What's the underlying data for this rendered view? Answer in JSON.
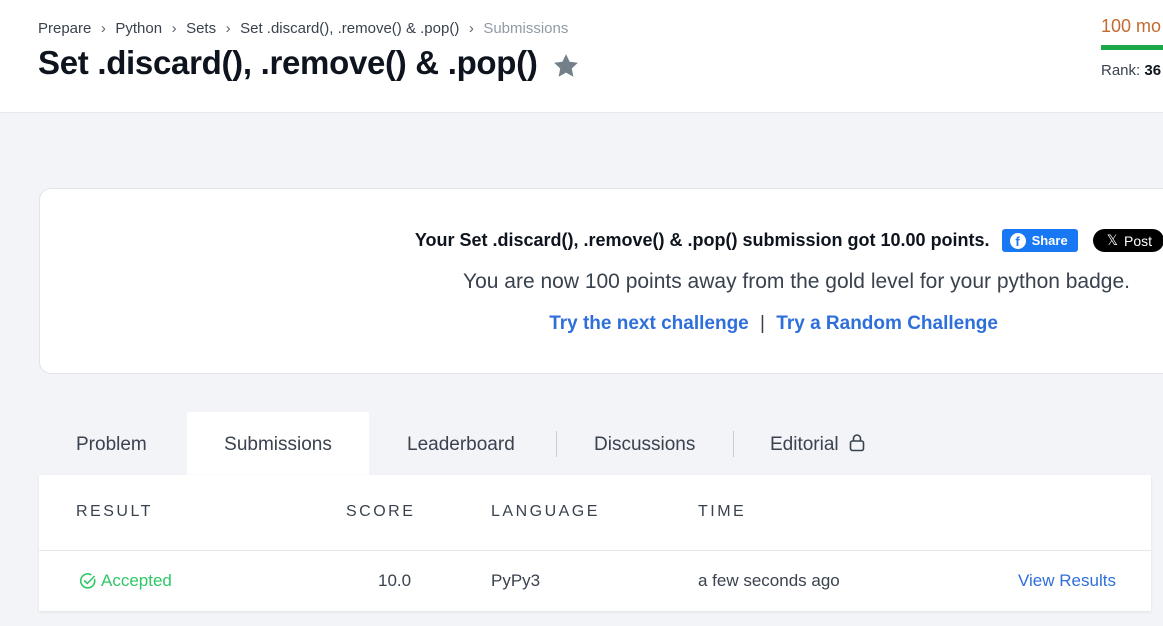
{
  "breadcrumb": [
    "Prepare",
    "Python",
    "Sets",
    "Set .discard(), .remove() & .pop()",
    "Submissions"
  ],
  "title": "Set .discard(), .remove() & .pop()",
  "header_score": {
    "text": "100 mo",
    "progress": 0.0,
    "rank_label": "Rank:",
    "rank_value": "36"
  },
  "result": {
    "message": "Your Set .discard(), .remove() & .pop() submission got 10.00 points.",
    "share_label": "Share",
    "post_label": "Post",
    "badge_text": "You are now 100 points away from the gold level for your python badge.",
    "next_link": "Try the next challenge",
    "separator": "|",
    "random_link": "Try a Random Challenge"
  },
  "tabs": [
    "Problem",
    "Submissions",
    "Leaderboard",
    "Discussions",
    "Editorial"
  ],
  "active_tab": "Submissions",
  "table": {
    "headers": [
      "RESULT",
      "SCORE",
      "LANGUAGE",
      "TIME"
    ],
    "rows": [
      {
        "result": "Accepted",
        "score": "10.0",
        "language": "PyPy3",
        "time": "a few seconds ago",
        "action": "View Results"
      }
    ]
  },
  "colors": {
    "accepted": "#2ec866",
    "link": "#2f6fdb",
    "score_orange": "#c26a32",
    "progress_green": "#1ba94c",
    "facebook": "#1877f2"
  },
  "icons": [
    "chevron-right-icon",
    "star-icon",
    "facebook-icon",
    "x-logo-icon",
    "lock-icon",
    "check-circle-icon"
  ]
}
